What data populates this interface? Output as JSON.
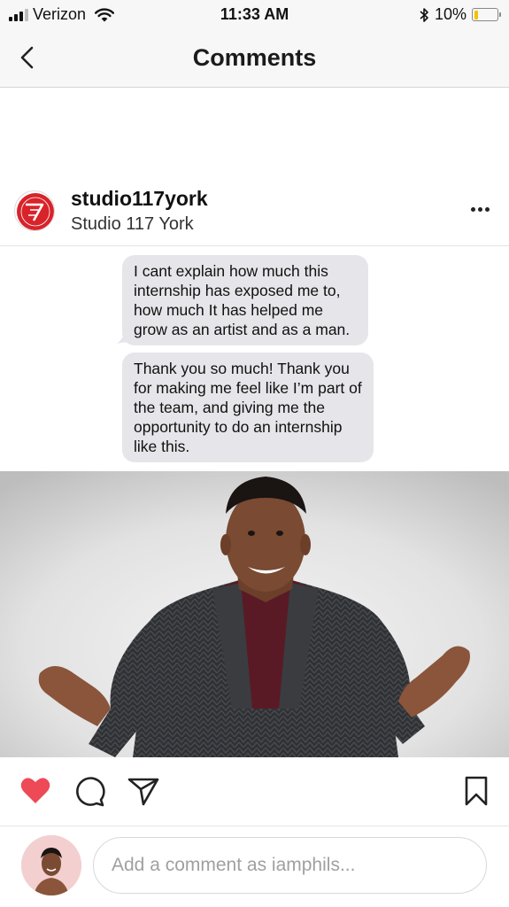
{
  "status_bar": {
    "carrier": "Verizon",
    "time": "11:33 AM",
    "battery": "10%",
    "battery_level": 0.1,
    "icons": [
      "signal-icon",
      "wifi-icon",
      "bluetooth-icon",
      "battery-icon"
    ]
  },
  "nav": {
    "title": "Comments",
    "back_icon": "chevron-left-icon"
  },
  "post": {
    "username": "studio117york",
    "location": "Studio 117 York",
    "more_icon": "more-horizontal-icon",
    "messages": [
      "I cant explain how much this internship has exposed me to, how much It has helped me grow as an artist and as a man.",
      "Thank you so much! Thank you for making me feel like I’m part of the team, and giving me the opportunity to do an internship like this."
    ]
  },
  "actions": {
    "like_icon": "heart-filled-icon",
    "comment_icon": "comment-icon",
    "share_icon": "send-icon",
    "save_icon": "bookmark-icon"
  },
  "comment_bar": {
    "placeholder": "Add a comment as iamphils..."
  },
  "colors": {
    "like": "#ed4956",
    "brand_logo": "#d8232a",
    "bubble": "#e6e6ea"
  }
}
